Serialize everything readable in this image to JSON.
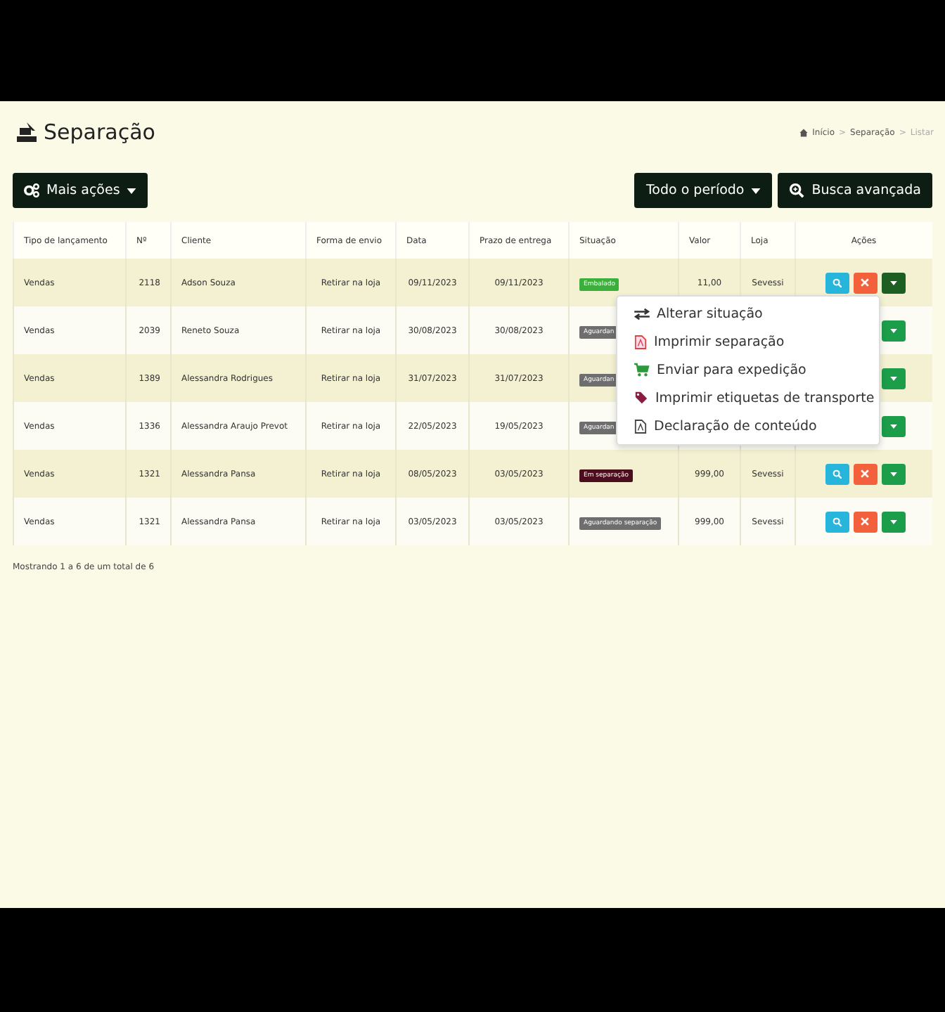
{
  "page": {
    "title": "Separação"
  },
  "breadcrumb": {
    "separator": ">",
    "items": [
      {
        "label": "Início",
        "current": false
      },
      {
        "label": "Separação",
        "current": false
      },
      {
        "label": "Listar",
        "current": true
      }
    ]
  },
  "toolbar": {
    "more_actions": "Mais ações",
    "period": "Todo o período",
    "advanced_search": "Busca avançada"
  },
  "table": {
    "columns": [
      "Tipo de lançamento",
      "Nº",
      "Cliente",
      "Forma de envio",
      "Data",
      "Prazo de entrega",
      "Situação",
      "Valor",
      "Loja",
      "Ações"
    ],
    "rows": [
      {
        "type": "Vendas",
        "number": "2118",
        "client": "Adson Souza",
        "shipping": "Retirar na loja",
        "date": "09/11/2023",
        "deadline": "09/11/2023",
        "status": {
          "label": "Embalado",
          "color": "#3cae3c"
        },
        "value": "11,00",
        "store": "Sevessi",
        "buttons": [
          {
            "kind": "search"
          },
          {
            "kind": "delete"
          },
          {
            "kind": "dropdown"
          }
        ],
        "expanded": true
      },
      {
        "type": "Vendas",
        "number": "2039",
        "client": "Reneto Souza",
        "shipping": "Retirar na loja",
        "date": "30/08/2023",
        "deadline": "30/08/2023",
        "status": {
          "label": "Aguardan",
          "color": "#6e6e6e"
        },
        "buttons": [
          {
            "kind": "dropdown"
          }
        ],
        "expanded": false
      },
      {
        "type": "Vendas",
        "number": "1389",
        "client": "Alessandra Rodrigues",
        "shipping": "Retirar na loja",
        "date": "31/07/2023",
        "deadline": "31/07/2023",
        "status": {
          "label": "Aguardan",
          "color": "#6e6e6e"
        },
        "buttons": [
          {
            "kind": "dropdown"
          }
        ],
        "expanded": false
      },
      {
        "type": "Vendas",
        "number": "1336",
        "client": "Alessandra Araujo Prevot",
        "shipping": "Retirar na loja",
        "date": "22/05/2023",
        "deadline": "19/05/2023",
        "status": {
          "label": "Aguardan",
          "color": "#6e6e6e"
        },
        "buttons": [
          {
            "kind": "dropdown"
          }
        ],
        "expanded": false
      },
      {
        "type": "Vendas",
        "number": "1321",
        "client": "Alessandra Pansa",
        "shipping": "Retirar na loja",
        "date": "08/05/2023",
        "deadline": "03/05/2023",
        "status": {
          "label": "Em separação",
          "color": "#4a0e1c"
        },
        "value": "999,00",
        "store": "Sevessi",
        "buttons": [
          {
            "kind": "search"
          },
          {
            "kind": "delete"
          },
          {
            "kind": "dropdown"
          }
        ],
        "expanded": false
      },
      {
        "type": "Vendas",
        "number": "1321",
        "client": "Alessandra Pansa",
        "shipping": "Retirar na loja",
        "date": "03/05/2023",
        "deadline": "03/05/2023",
        "status": {
          "label": "Aguardando separação",
          "color": "#6e6e6e"
        },
        "value": "999,00",
        "store": "Sevessi",
        "buttons": [
          {
            "kind": "search"
          },
          {
            "kind": "delete"
          },
          {
            "kind": "dropdown"
          }
        ],
        "expanded": false
      }
    ]
  },
  "menu": {
    "items": [
      {
        "label": "Alterar situação",
        "kind": "swap"
      },
      {
        "label": "Imprimir separação",
        "kind": "pdf"
      },
      {
        "label": "Enviar para expedição",
        "kind": "cart"
      },
      {
        "label": "Imprimir etiquetas de transporte",
        "kind": "tag"
      },
      {
        "label": "Declaração de conteúdo",
        "kind": "document"
      }
    ]
  },
  "footer": "Mostrando 1 a 6 de um total de 6"
}
